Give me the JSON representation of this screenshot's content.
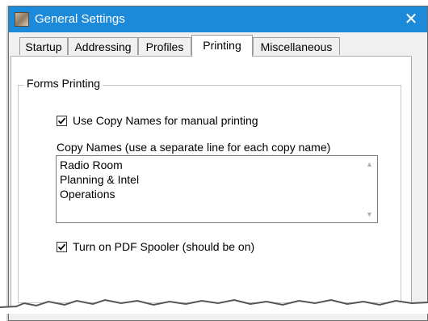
{
  "window": {
    "title": "General Settings",
    "close_glyph": "✕",
    "app_icon": "settings-app-icon"
  },
  "tabs": [
    {
      "label": "Startup",
      "active": false
    },
    {
      "label": "Addressing",
      "active": false
    },
    {
      "label": "Profiles",
      "active": false
    },
    {
      "label": "Printing",
      "active": true
    },
    {
      "label": "Miscellaneous",
      "active": false
    }
  ],
  "forms_printing": {
    "group_label": "Forms Printing",
    "use_copy_names": {
      "label": "Use Copy Names for manual printing",
      "checked": true
    },
    "copy_names_label": "Copy Names (use a separate line for each copy name)",
    "copy_names": [
      "Radio Room",
      "Planning & Intel",
      "Operations"
    ],
    "pdf_spooler": {
      "label": "Turn on PDF Spooler (should be on)",
      "checked": true
    }
  },
  "colors": {
    "titlebar": "#1c8ad9",
    "dialog_bg": "#f0f0f0",
    "panel_bg": "#ffffff"
  }
}
